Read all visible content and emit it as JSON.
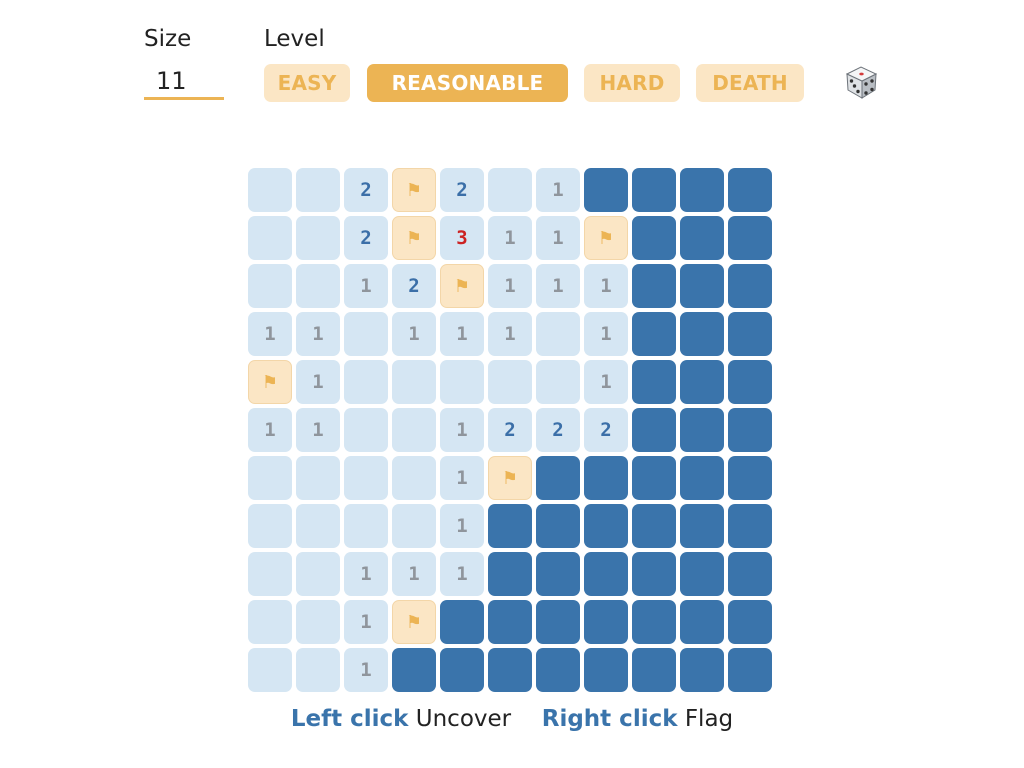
{
  "controls": {
    "size_label": "Size",
    "size_value": "11",
    "level_label": "Level",
    "levels": [
      {
        "label": "EASY",
        "active": false
      },
      {
        "label": "REASONABLE",
        "active": true
      },
      {
        "label": "HARD",
        "active": false
      },
      {
        "label": "DEATH",
        "active": false
      }
    ],
    "random_icon": "dice-icon"
  },
  "board": {
    "size": 11,
    "legend": "O = opened empty, H = hidden, F = flagged, digit = adjacent mine count",
    "rows": [
      [
        "O",
        "O",
        "2",
        "F",
        "2",
        "O",
        "1",
        "H",
        "H",
        "H",
        "H"
      ],
      [
        "O",
        "O",
        "2",
        "F",
        "3",
        "1",
        "1",
        "F",
        "H",
        "H",
        "H"
      ],
      [
        "O",
        "O",
        "1",
        "2",
        "F",
        "1",
        "1",
        "1",
        "H",
        "H",
        "H"
      ],
      [
        "1",
        "1",
        "O",
        "1",
        "1",
        "1",
        "O",
        "1",
        "H",
        "H",
        "H"
      ],
      [
        "F",
        "1",
        "O",
        "O",
        "O",
        "O",
        "O",
        "1",
        "H",
        "H",
        "H"
      ],
      [
        "1",
        "1",
        "O",
        "O",
        "1",
        "2",
        "2",
        "2",
        "H",
        "H",
        "H"
      ],
      [
        "O",
        "O",
        "O",
        "O",
        "1",
        "F",
        "H",
        "H",
        "H",
        "H",
        "H"
      ],
      [
        "O",
        "O",
        "O",
        "O",
        "1",
        "H",
        "H",
        "H",
        "H",
        "H",
        "H"
      ],
      [
        "O",
        "O",
        "1",
        "1",
        "1",
        "H",
        "H",
        "H",
        "H",
        "H",
        "H"
      ],
      [
        "O",
        "O",
        "1",
        "F",
        "H",
        "H",
        "H",
        "H",
        "H",
        "H",
        "H"
      ],
      [
        "O",
        "O",
        "1",
        "H",
        "H",
        "H",
        "H",
        "H",
        "H",
        "H",
        "H"
      ]
    ],
    "flag_glyph": "⚑"
  },
  "help": {
    "left_key": "Left click",
    "left_action": "Uncover",
    "right_key": "Right click",
    "right_action": "Flag"
  },
  "colors": {
    "accent": "#ecb454",
    "accent_light": "#fbe6c5",
    "cell_open": "#d5e6f3",
    "cell_hidden": "#3a74ab",
    "num_1": "#8f959c",
    "num_2": "#3b6fa8",
    "num_3": "#cc2222"
  }
}
